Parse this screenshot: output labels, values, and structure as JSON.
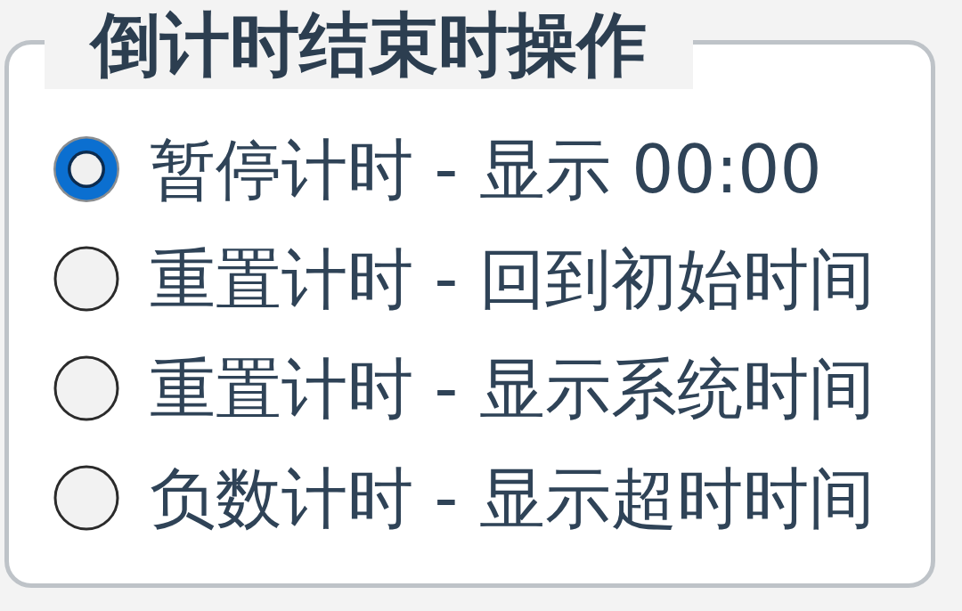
{
  "group": {
    "title": "倒计时结束时操作",
    "options": [
      {
        "label": "暂停计时 - 显示 00:00",
        "selected": true
      },
      {
        "label": "重置计时 - 回到初始时间",
        "selected": false
      },
      {
        "label": "重置计时 - 显示系统时间",
        "selected": false
      },
      {
        "label": "负数计时 - 显示超时时间",
        "selected": false
      }
    ]
  }
}
